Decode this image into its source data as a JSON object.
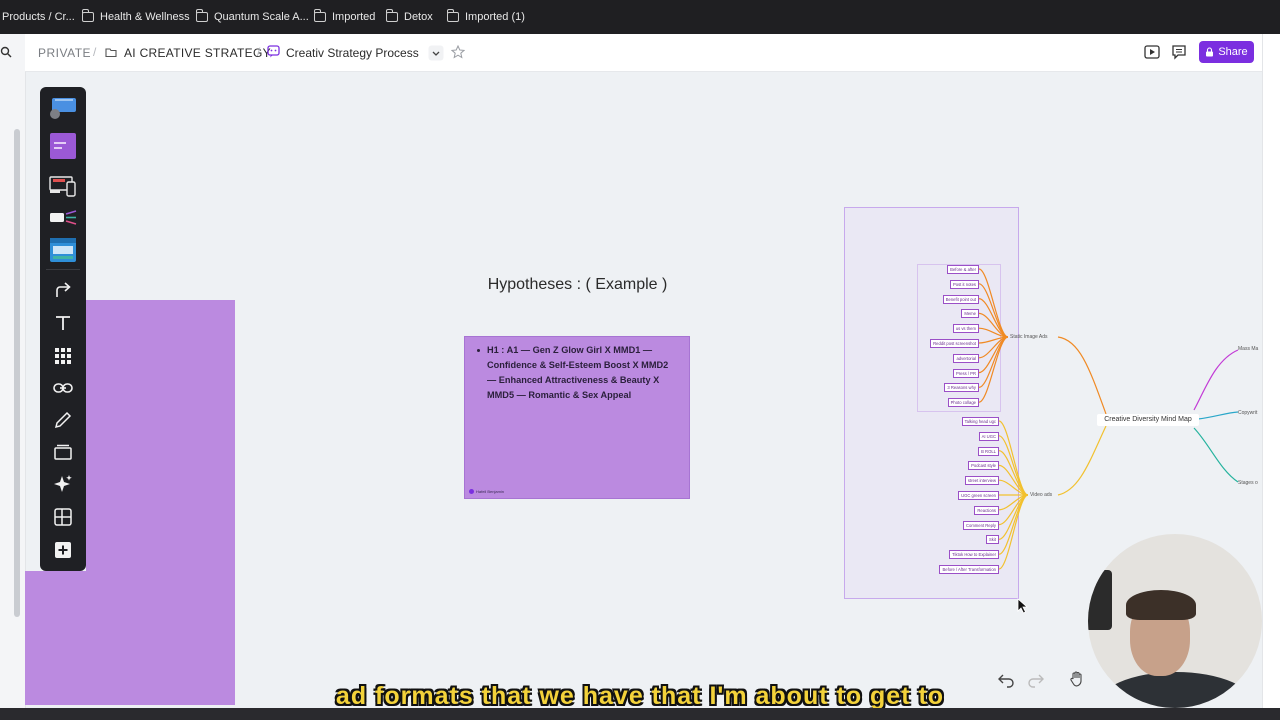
{
  "bookmarks": [
    "Products / Cr...",
    "Health & Wellness",
    "Quantum Scale A...",
    "Imported",
    "Detox",
    "Imported (1)"
  ],
  "breadcrumb": {
    "root": "PRIVATE",
    "folder": "AI CREATIVE STRATEGY",
    "page": "Creativ Strategy Process"
  },
  "topbar": {
    "share_label": "Share"
  },
  "canvas": {
    "hypotheses_title": "Hypotheses : ( Example )",
    "card_text": "H1 : A1 — Gen Z Glow Girl X  MMD1 — Confidence & Self-Esteem Boost X MMD2 — Enhanced Attractiveness & Beauty X MMD5 — Romantic & Sex Appeal",
    "card_footer": "Hafeil Benjamin"
  },
  "mindmap": {
    "center": "Creative Diversity Mind Map",
    "static_label": "Static Image Ads",
    "video_label": "Video ads",
    "right_labels": [
      "Mass Ma",
      "Copywrit",
      "Stages o"
    ],
    "static_items": [
      "Before & after",
      "Post it notes",
      "Benefit point out",
      "Meme",
      "us vs them",
      "Reddit post screenshot",
      "advertorial",
      "Press / PR",
      "3 Reasons why",
      "Photo collage"
    ],
    "video_items": [
      "Talking head ugc",
      "AI UGC",
      "B ROLL",
      "Podcast style",
      "street interview",
      "UGC green screen",
      "Reactions",
      "Comment Reply",
      "Skit",
      "Tiktok How to Explainer",
      "Before / After Transformation"
    ]
  },
  "caption": "ad formats that we have that I'm about to get to",
  "colors": {
    "accent": "#7b2fe0",
    "card": "#bb8ae0",
    "toolbar": "#1f2024"
  }
}
